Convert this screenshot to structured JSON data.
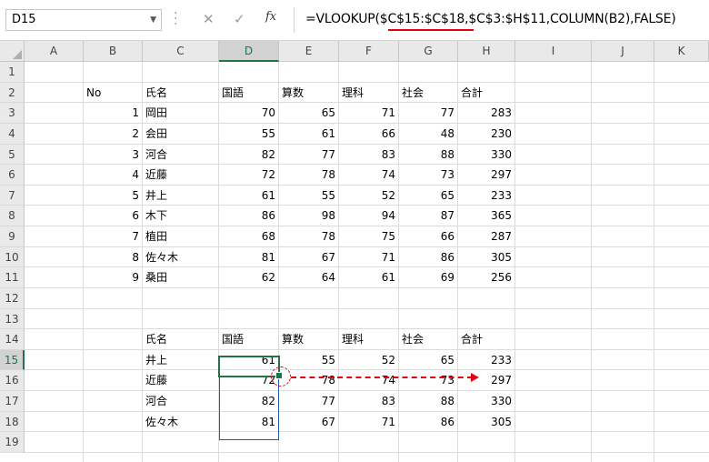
{
  "formula_bar": {
    "name_box": "D15",
    "cancel_glyph": "✕",
    "enter_glyph": "✓",
    "fx_label": "fx",
    "formula": "=VLOOKUP($C$15:$C$18,$C$3:$H$11,COLUMN(B2),FALSE)"
  },
  "columns": [
    "A",
    "B",
    "C",
    "D",
    "E",
    "F",
    "G",
    "H",
    "I",
    "J",
    "K"
  ],
  "rows": [
    "1",
    "2",
    "3",
    "4",
    "5",
    "6",
    "7",
    "8",
    "9",
    "10",
    "11",
    "12",
    "13",
    "14",
    "15",
    "16",
    "17",
    "18",
    "19"
  ],
  "table1": {
    "headers": [
      "No",
      "氏名",
      "国語",
      "算数",
      "理科",
      "社会",
      "合計"
    ],
    "rows": [
      [
        "1",
        "岡田",
        "70",
        "65",
        "71",
        "77",
        "283"
      ],
      [
        "2",
        "会田",
        "55",
        "61",
        "66",
        "48",
        "230"
      ],
      [
        "3",
        "河合",
        "82",
        "77",
        "83",
        "88",
        "330"
      ],
      [
        "4",
        "近藤",
        "72",
        "78",
        "74",
        "73",
        "297"
      ],
      [
        "5",
        "井上",
        "61",
        "55",
        "52",
        "65",
        "233"
      ],
      [
        "6",
        "木下",
        "86",
        "98",
        "94",
        "87",
        "365"
      ],
      [
        "7",
        "植田",
        "68",
        "78",
        "75",
        "66",
        "287"
      ],
      [
        "8",
        "佐々木",
        "81",
        "67",
        "71",
        "86",
        "305"
      ],
      [
        "9",
        "桑田",
        "62",
        "64",
        "61",
        "69",
        "256"
      ]
    ]
  },
  "table2": {
    "headers": [
      "氏名",
      "国語",
      "算数",
      "理科",
      "社会",
      "合計"
    ],
    "rows": [
      [
        "井上",
        "61",
        "55",
        "52",
        "65",
        "233"
      ],
      [
        "近藤",
        "72",
        "78",
        "74",
        "73",
        "297"
      ],
      [
        "河合",
        "82",
        "77",
        "83",
        "88",
        "330"
      ],
      [
        "佐々木",
        "81",
        "67",
        "71",
        "86",
        "305"
      ]
    ]
  },
  "accent": {
    "excel_green": "#217346",
    "annotation_red": "#e60012",
    "selection_blue": "#1f5fa8"
  }
}
